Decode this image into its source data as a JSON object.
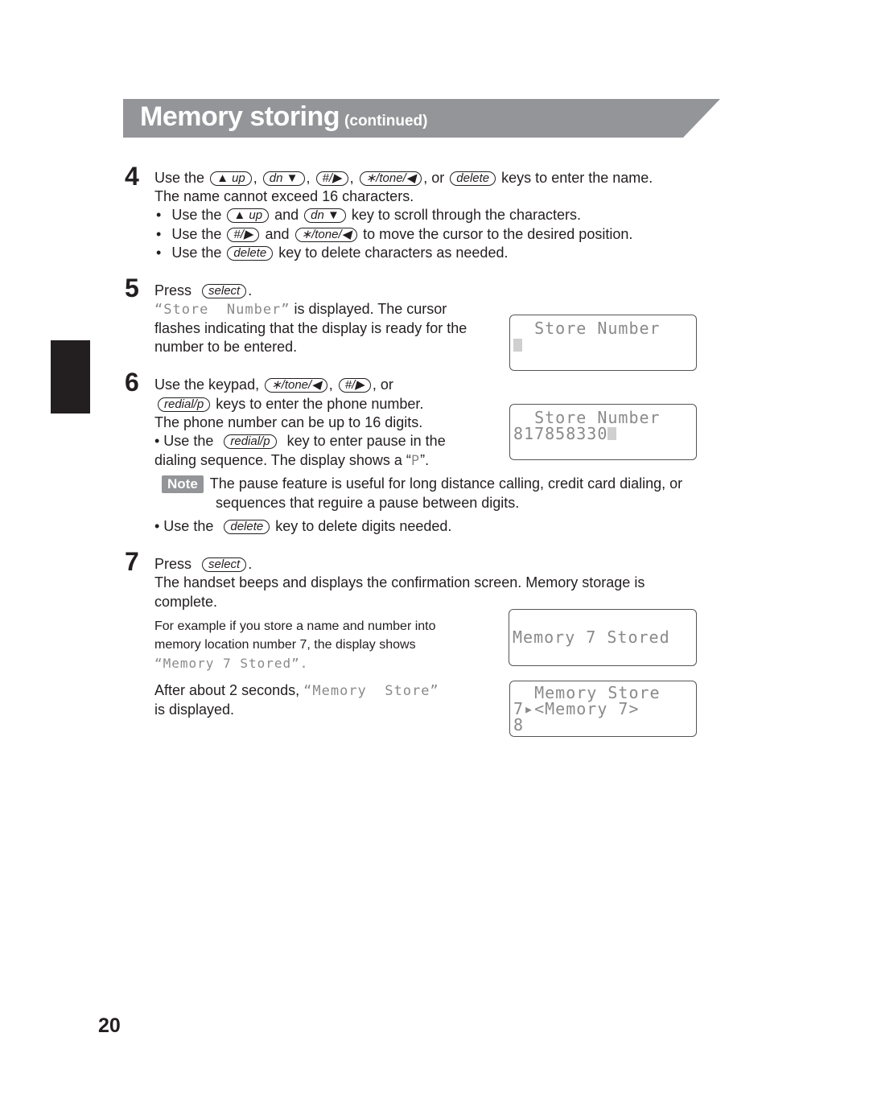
{
  "header": {
    "title": "Memory storing",
    "subtitle": "(continued)",
    "bg_color": "#939598"
  },
  "keys": {
    "up": "▲ up",
    "dn": "dn ▼",
    "hash": "#/▶",
    "star": "∗/tone/◀",
    "delete": "delete",
    "select": "select",
    "redial": "redial/p"
  },
  "step4": {
    "number": "4",
    "l1_a": "Use the",
    "l1_b": ",",
    "l1_c": ",",
    "l1_d": ",",
    "l1_e": ", or",
    "l1_f": "keys to enter the name.",
    "l2": "The name cannot exceed 16 characters.",
    "b1_a": "Use the",
    "b1_b": "and",
    "b1_c": "key to scroll through the characters.",
    "b2_a": "Use the",
    "b2_b": "and",
    "b2_c": "to move the cursor to the desired position.",
    "b3_a": "Use the",
    "b3_b": "key to delete characters as needed."
  },
  "step5": {
    "number": "5",
    "press": "Press",
    "period": ".",
    "l2_lcd": "“Store  Number”",
    "l2_rest": "is displayed. The cursor",
    "l3": "flashes indicating that the display is ready for the",
    "l4": "number to be entered."
  },
  "step6": {
    "number": "6",
    "l1_a": "Use the keypad,",
    "l1_b": ",",
    "l1_c": ", or",
    "l2": "keys to enter the phone number.",
    "l3": "The phone number can be up to 16 digits.",
    "b1_a": "• Use the",
    "b1_b": "key to enter pause in the",
    "l5_a": "dialing sequence. The display shows a “",
    "l5_lcd": "P",
    "l5_b": "”.",
    "note_label": "Note",
    "note_l1": "The pause feature is useful for long distance calling, credit card dialing, or",
    "note_l2": "sequences that reguire a pause between digits.",
    "b2_a": "• Use the",
    "b2_b": "key to delete digits needed."
  },
  "step7": {
    "number": "7",
    "press": "Press",
    "period": ".",
    "l2": "The handset beeps and displays the confirmation screen. Memory storage is",
    "l3": "complete.",
    "ex_l1": "For example if you store a name and number into",
    "ex_l2": "memory location number 7, the display shows",
    "ex_l3": "“Memory 7 Stored”.",
    "after_a": "After about 2 seconds,",
    "after_lcd": "“Memory  Store”",
    "after_l2": "is displayed."
  },
  "displays": {
    "d1": {
      "row1": "  Store Number",
      "row2": ""
    },
    "d2": {
      "row1": "  Store Number",
      "row2": "817858330"
    },
    "d3": {
      "row1": "Memory 7 Stored"
    },
    "d4": {
      "row1": "  Memory Store",
      "row2": "7▸<Memory 7>",
      "row3": "8"
    }
  },
  "page_number": "20"
}
